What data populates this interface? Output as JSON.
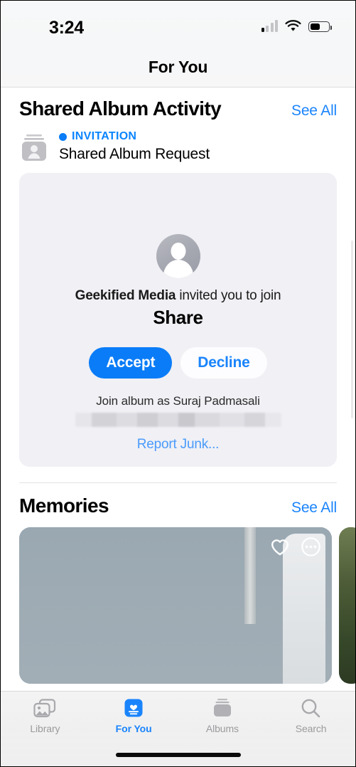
{
  "status_bar": {
    "time": "3:24",
    "signal_icon": "cellular-signal-icon",
    "signal_bars_filled": 1,
    "signal_bars_total": 4,
    "wifi_icon": "wifi-icon",
    "battery_icon": "battery-icon",
    "battery_level_percent": 55
  },
  "nav": {
    "title": "For You"
  },
  "shared_album_activity": {
    "title": "Shared Album Activity",
    "see_all_label": "See All",
    "item": {
      "icon": "shared-album-icon",
      "kicker": "INVITATION",
      "subject": "Shared Album Request",
      "card": {
        "avatar_icon": "person-avatar-icon",
        "inviter_name": "Geekified Media",
        "invite_text": " invited you to join",
        "album_name": "Share",
        "accept_label": "Accept",
        "decline_label": "Decline",
        "join_as": "Join album as Suraj Padmasali",
        "redacted_value": "",
        "report_junk_label": "Report Junk..."
      }
    }
  },
  "memories": {
    "title": "Memories",
    "see_all_label": "See All",
    "cards": [
      {
        "name": "memory-card-people-outdoors",
        "favorite_icon": "heart-icon",
        "more_icon": "ellipsis-circle-icon"
      },
      {
        "name": "memory-card-foliage"
      }
    ]
  },
  "tab_bar": {
    "tabs": [
      {
        "label": "Library",
        "icon": "photos-library-icon",
        "active": false
      },
      {
        "label": "For You",
        "icon": "for-you-icon",
        "active": true
      },
      {
        "label": "Albums",
        "icon": "albums-icon",
        "active": false
      },
      {
        "label": "Search",
        "icon": "search-icon",
        "active": false
      }
    ]
  },
  "colors": {
    "accent_blue": "#0a7cf7",
    "link_blue": "#1a84fc",
    "card_bg": "#f0f0f5",
    "inactive_gray": "#9b9b9e"
  }
}
